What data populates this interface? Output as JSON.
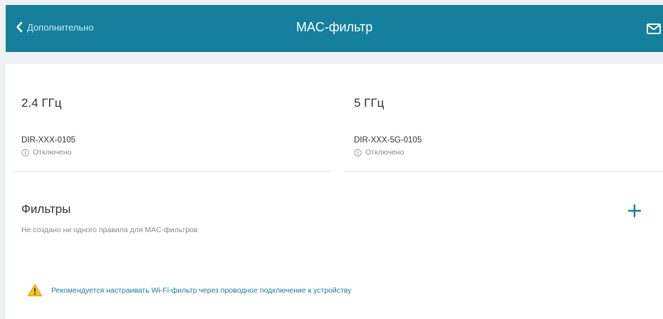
{
  "header": {
    "back_label": "Дополнительно",
    "title": "MAC-фильтр",
    "icons": {
      "back": "chevron-left-icon",
      "mail": "mail-icon"
    }
  },
  "bands": [
    {
      "title": "2.4 ГГц",
      "ssid": "DIR-XXX-0105",
      "status": "Отключено",
      "status_icon": "info-icon"
    },
    {
      "title": "5 ГГц",
      "ssid": "DIR-XXX-5G-0105",
      "status": "Отключено",
      "status_icon": "info-icon"
    }
  ],
  "filters": {
    "title": "Фильтры",
    "empty_text": "Не создано ни одного правила для MAC-фильтров",
    "add_icon": "plus-icon"
  },
  "warning": {
    "icon": "warning-icon",
    "text": "Рекомендуется настраивать Wi-Fi-фильтр через проводное подключение к устройству"
  },
  "colors": {
    "header_bg": "#14809b",
    "page_bg": "#f0f1f2",
    "accent": "#14809b",
    "warning": "#f2c318"
  }
}
